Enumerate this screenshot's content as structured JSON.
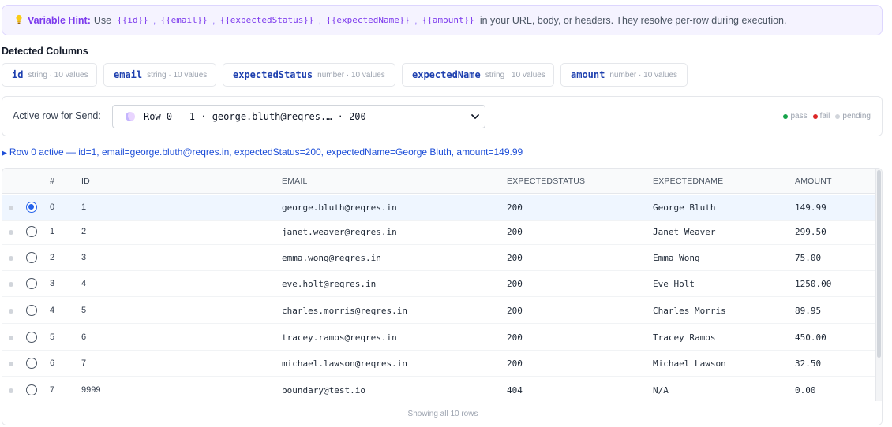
{
  "hint": {
    "label": "Variable Hint:",
    "prefix": "Use",
    "variables": [
      "{{id}}",
      "{{email}}",
      "{{expectedStatus}}",
      "{{expectedName}}",
      "{{amount}}"
    ],
    "suffix": "in your URL, body, or headers. They resolve per-row during execution."
  },
  "detected": {
    "title": "Detected Columns",
    "columns": [
      {
        "name": "id",
        "meta": "string · 10 values"
      },
      {
        "name": "email",
        "meta": "string · 10 values"
      },
      {
        "name": "expectedStatus",
        "meta": "number · 10 values"
      },
      {
        "name": "expectedName",
        "meta": "string · 10 values"
      },
      {
        "name": "amount",
        "meta": "number · 10 values"
      }
    ]
  },
  "active_row": {
    "label": "Active row for Send:",
    "selected": "Row 0 — 1 · george.bluth@reqres.… · 200",
    "legend": [
      {
        "label": "pass",
        "color": "#16a34a"
      },
      {
        "label": "fail",
        "color": "#dc2626"
      },
      {
        "label": "pending",
        "color": "#d1d5db"
      }
    ],
    "summary": "Row 0 active — id=1, email=george.bluth@reqres.in, expectedStatus=200, expectedName=George Bluth, amount=149.99"
  },
  "table": {
    "headers": {
      "index": "#",
      "id": "ID",
      "email": "EMAIL",
      "status": "EXPECTEDSTATUS",
      "name": "EXPECTEDNAME",
      "amount": "AMOUNT"
    },
    "rows": [
      {
        "index": "0",
        "id": "1",
        "email": "george.bluth@reqres.in",
        "status": "200",
        "name": "George Bluth",
        "amount": "149.99",
        "selected": true
      },
      {
        "index": "1",
        "id": "2",
        "email": "janet.weaver@reqres.in",
        "status": "200",
        "name": "Janet Weaver",
        "amount": "299.50",
        "selected": false
      },
      {
        "index": "2",
        "id": "3",
        "email": "emma.wong@reqres.in",
        "status": "200",
        "name": "Emma Wong",
        "amount": "75.00",
        "selected": false
      },
      {
        "index": "3",
        "id": "4",
        "email": "eve.holt@reqres.in",
        "status": "200",
        "name": "Eve Holt",
        "amount": "1250.00",
        "selected": false
      },
      {
        "index": "4",
        "id": "5",
        "email": "charles.morris@reqres.in",
        "status": "200",
        "name": "Charles Morris",
        "amount": "89.95",
        "selected": false
      },
      {
        "index": "5",
        "id": "6",
        "email": "tracey.ramos@reqres.in",
        "status": "200",
        "name": "Tracey Ramos",
        "amount": "450.00",
        "selected": false
      },
      {
        "index": "6",
        "id": "7",
        "email": "michael.lawson@reqres.in",
        "status": "200",
        "name": "Michael Lawson",
        "amount": "32.50",
        "selected": false
      },
      {
        "index": "7",
        "id": "9999",
        "email": "boundary@test.io",
        "status": "404",
        "name": "N/A",
        "amount": "0.00",
        "selected": false
      }
    ],
    "footer": "Showing all 10 rows"
  }
}
